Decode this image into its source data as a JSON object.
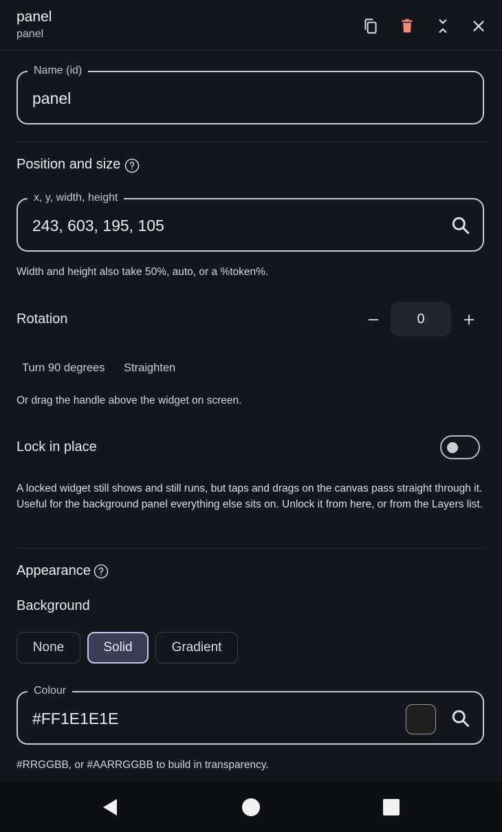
{
  "header": {
    "title": "panel",
    "subtitle": "panel",
    "actions": [
      "duplicate-icon",
      "delete-icon",
      "collapse-icon",
      "close-icon"
    ],
    "delete_color": "#f28b82"
  },
  "name_field": {
    "label": "Name (id)",
    "value": "panel"
  },
  "position": {
    "section_title": "Position and size",
    "field_label": "x, y, width, height",
    "value": "243, 603, 195, 105",
    "hint": "Width and height also take 50%, auto, or a %token%."
  },
  "rotation": {
    "label": "Rotation",
    "value": "0",
    "turn_label": "Turn 90 degrees",
    "straighten_label": "Straighten",
    "hint": "Or drag the handle above the widget on screen."
  },
  "lock": {
    "label": "Lock in place",
    "on": false,
    "description": "A locked widget still shows and still runs, but taps and drags on the canvas pass straight through it. Useful for the background panel everything else sits on. Unlock it from here, or from the Layers list."
  },
  "appearance": {
    "section_title": "Appearance",
    "background_label": "Background",
    "options": [
      "None",
      "Solid",
      "Gradient"
    ],
    "selected": "Solid",
    "colour_label": "Colour",
    "colour_value": "#FF1E1E1E",
    "swatch_color": "#1e1e1e",
    "colour_hint": "#RRGGBB, or #AARRGGBB to build in transparency."
  },
  "navbar": [
    "back-icon",
    "home-icon",
    "recents-icon"
  ]
}
